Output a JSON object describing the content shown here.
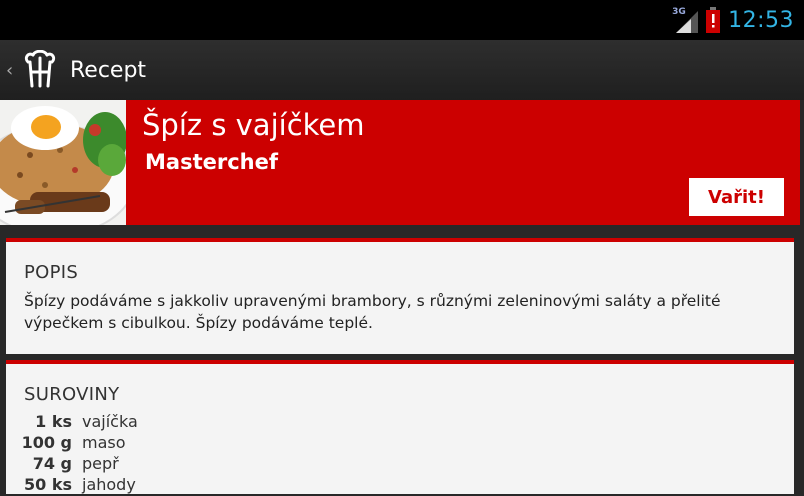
{
  "status_bar": {
    "network_label": "3G",
    "time": "12:53",
    "battery_color": "#cc0000",
    "clock_color": "#33b5e5"
  },
  "action_bar": {
    "title": "Recept",
    "up_icon": "‹",
    "logo_icon": "chef-hat-icon"
  },
  "recipe": {
    "title": "Špíz s vajíčkem",
    "author": "Masterchef",
    "cook_button": "Vařit!"
  },
  "description": {
    "heading": "POPIS",
    "text": "Špízy podáváme s jakkoliv upravenými brambory, s různými zeleninovými saláty a přelité výpečkem s cibulkou. Špízy podáváme teplé."
  },
  "ingredients": {
    "heading": "SUROVINY",
    "items": [
      {
        "qty": "1 ks",
        "name": "vajíčka"
      },
      {
        "qty": "100 g",
        "name": "maso"
      },
      {
        "qty": "74 g",
        "name": "pepř"
      },
      {
        "qty": "50 ks",
        "name": "jahody"
      }
    ]
  },
  "colors": {
    "accent": "#cc0000",
    "card_bg": "#f4f4f4",
    "page_bg": "#282828"
  }
}
